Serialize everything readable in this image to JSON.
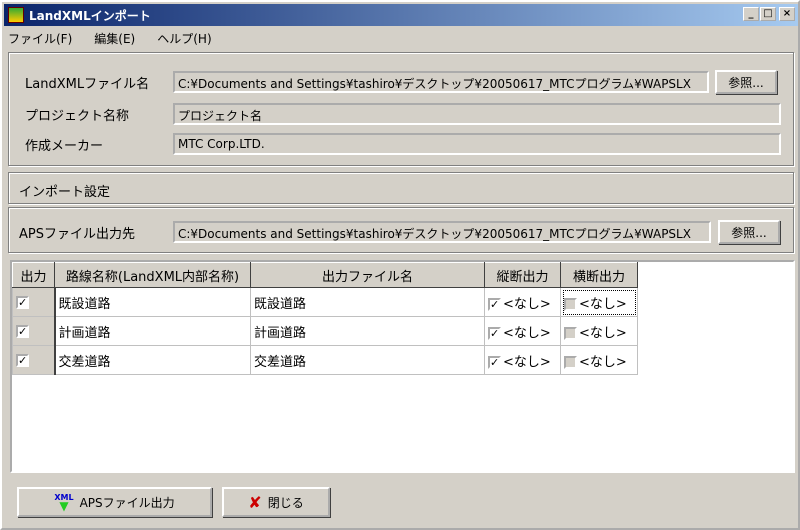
{
  "window": {
    "title": "LandXMLインポート",
    "min": "_",
    "max": "□",
    "close": "×"
  },
  "menu": [
    "ファイル(F)",
    "編集(E)",
    "ヘルプ(H)"
  ],
  "info": {
    "landxml_label": "LandXMLファイル名",
    "landxml_value": "C:¥Documents and Settings¥tashiro¥デスクトップ¥20050617_MTCプログラム¥WAPSLX",
    "browse1": "参照...",
    "project_label": "プロジェクト名称",
    "project_value": "プロジェクト名",
    "maker_label": "作成メーカー",
    "maker_value": "MTC Corp.LTD."
  },
  "import": {
    "header": "インポート設定",
    "aps_label": "APSファイル出力先",
    "aps_value": "C:¥Documents and Settings¥tashiro¥デスクトップ¥20050617_MTCプログラム¥WAPSLX",
    "browse2": "参照..."
  },
  "table": {
    "columns": [
      "出力",
      "路線名称(LandXML内部名称)",
      "出力ファイル名",
      "縦断出力",
      "横断出力"
    ],
    "rows": [
      {
        "output": true,
        "name": "既設道路",
        "file": "既設道路",
        "longi_checked": true,
        "longi": "<なし>",
        "cross_checked": false,
        "cross": "<なし>"
      },
      {
        "output": true,
        "name": "計画道路",
        "file": "計画道路",
        "longi_checked": true,
        "longi": "<なし>",
        "cross_checked": false,
        "cross": "<なし>"
      },
      {
        "output": true,
        "name": "交差道路",
        "file": "交差道路",
        "longi_checked": true,
        "longi": "<なし>",
        "cross_checked": false,
        "cross": "<なし>"
      }
    ]
  },
  "buttons": {
    "export": "APSファイル出力",
    "export_icon_text": "XML",
    "close": "閉じる"
  }
}
